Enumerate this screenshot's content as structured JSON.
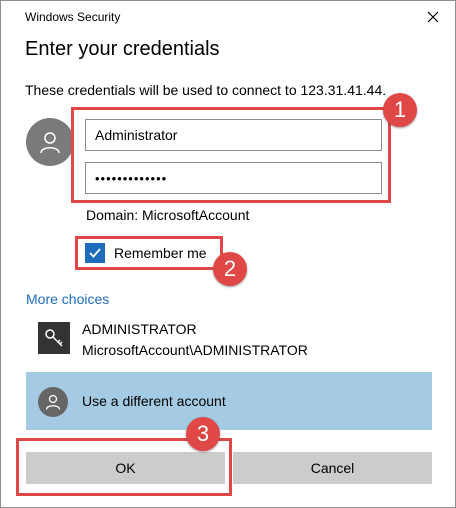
{
  "window": {
    "title": "Windows Security"
  },
  "dialog": {
    "heading": "Enter your credentials",
    "description": "These credentials will be used to connect to 123.31.41.44.",
    "username_value": "Administrator",
    "password_value": "•••••••••••••",
    "domain": "Domain: MicrosoftAccount",
    "remember_label": "Remember me",
    "remember_checked": true,
    "more_choices": "More choices",
    "account": {
      "name": "ADMINISTRATOR",
      "sub": "MicrosoftAccount\\ADMINISTRATOR"
    },
    "different_account": "Use a different account",
    "ok_label": "OK",
    "cancel_label": "Cancel"
  },
  "annotations": {
    "b1": "1",
    "b2": "2",
    "b3": "3"
  },
  "colors": {
    "accent": "#1e6cbb",
    "highlight": "#e04848",
    "selected_bg": "#a4cbe3",
    "button_bg": "#cccccc"
  }
}
